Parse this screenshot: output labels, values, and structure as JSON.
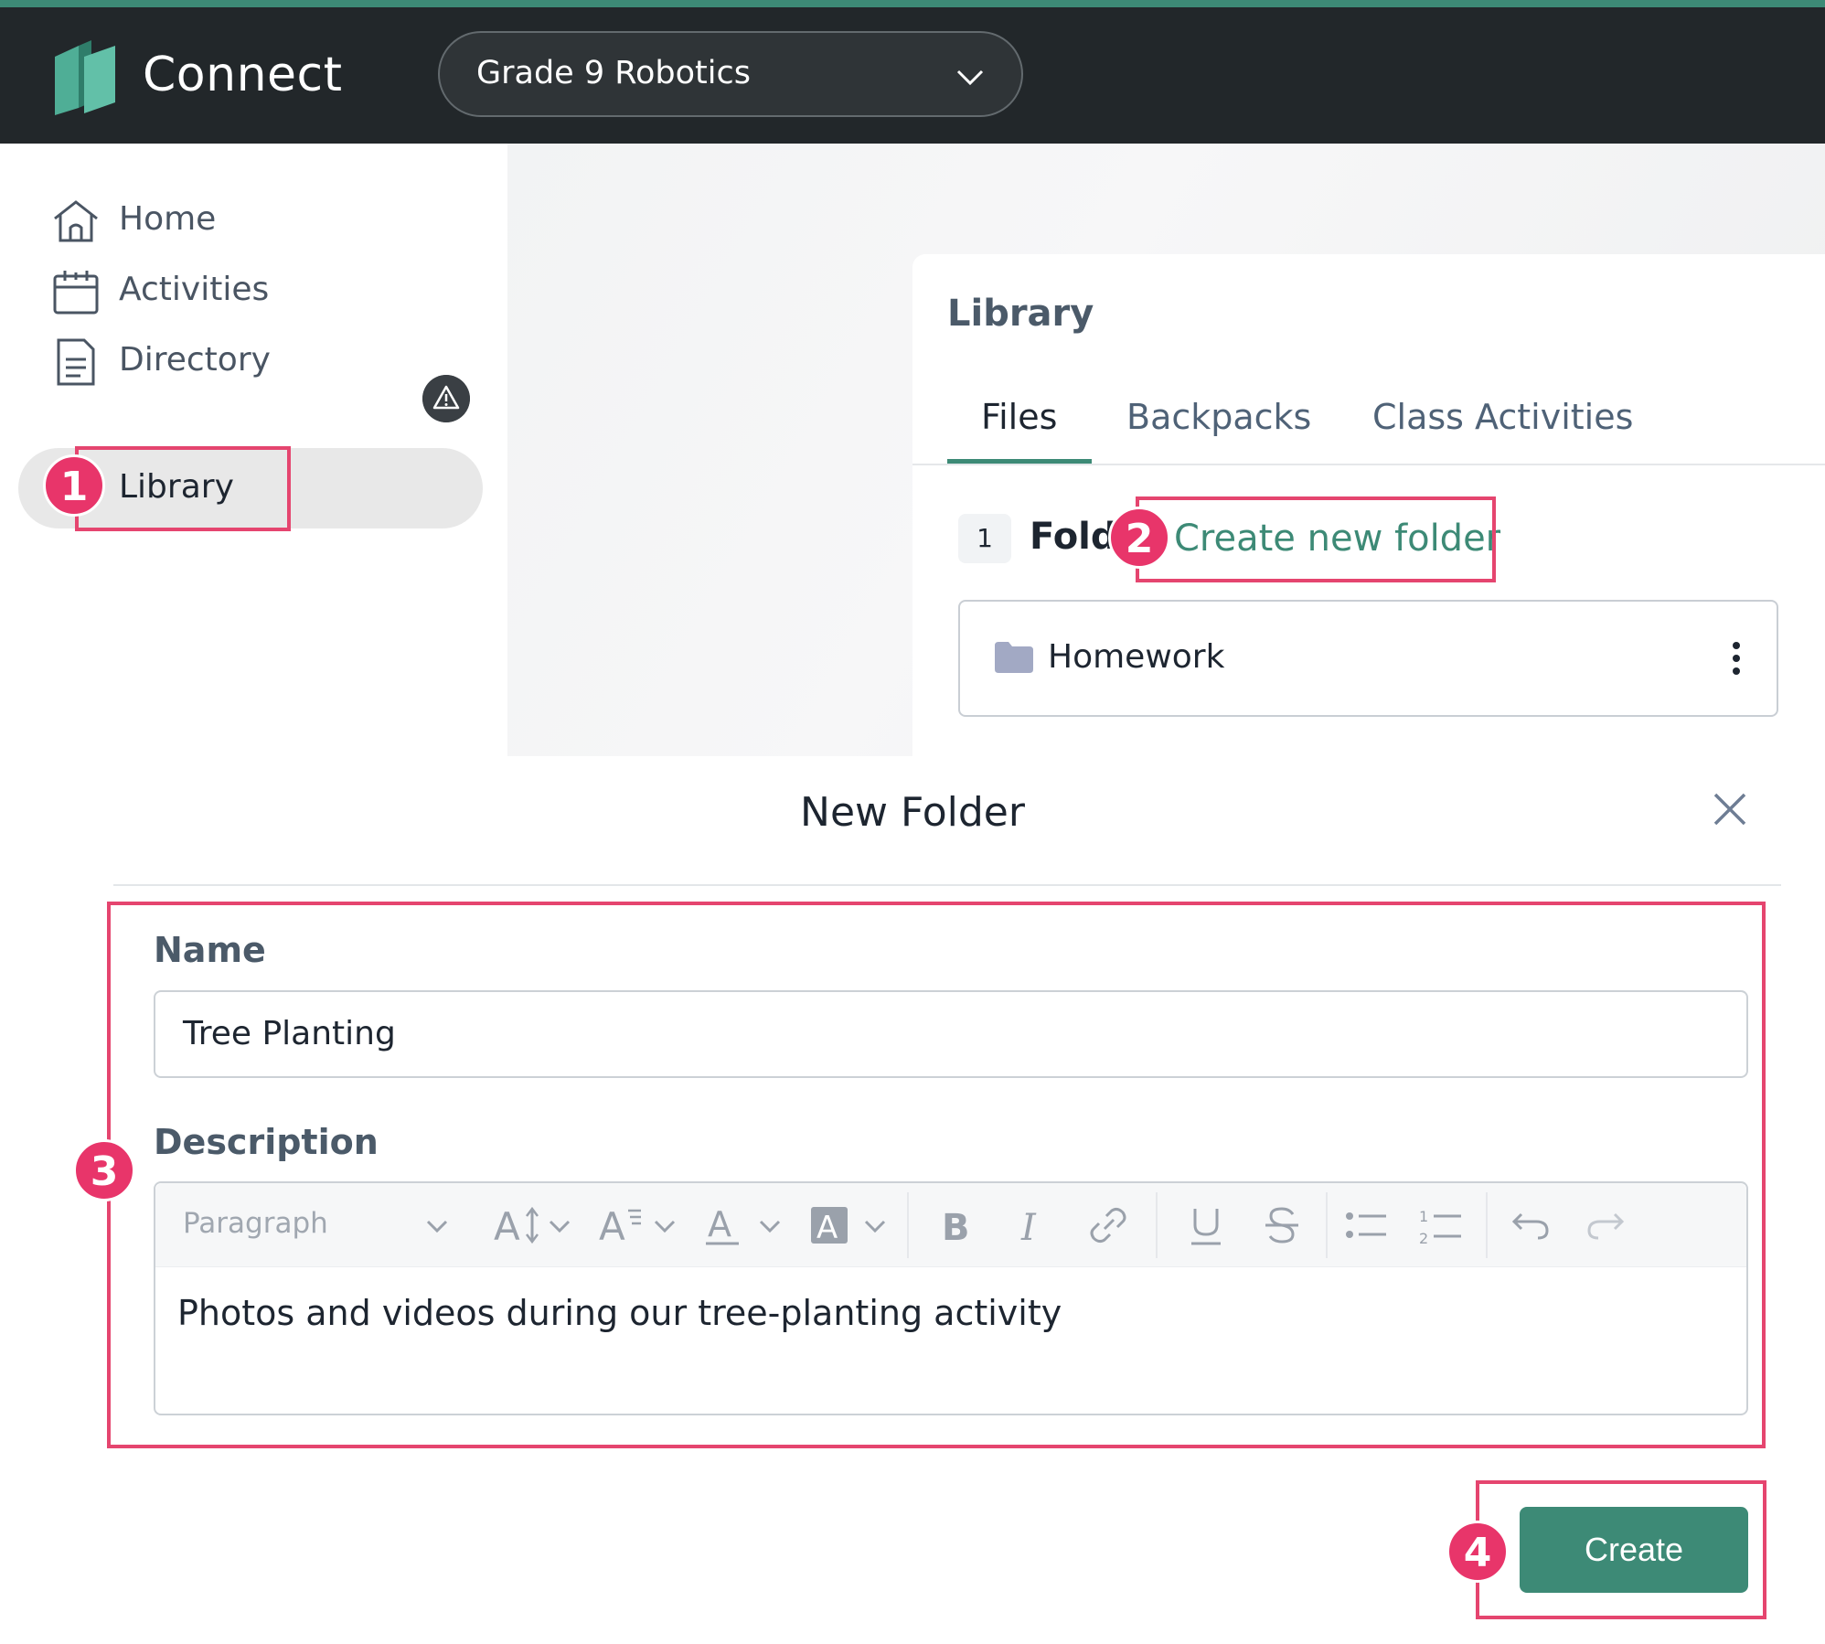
{
  "app": {
    "brand": "Connect",
    "class_selector": "Grade 9 Robotics"
  },
  "sidebar": {
    "items": [
      {
        "label": "Home",
        "icon": "home-icon"
      },
      {
        "label": "Activities",
        "icon": "calendar-icon"
      },
      {
        "label": "Directory",
        "icon": "document-icon",
        "badge_icon": "warning-icon"
      },
      {
        "label": "Library",
        "icon": "library-icon",
        "active": true
      }
    ]
  },
  "library": {
    "title": "Library",
    "tabs": [
      {
        "label": "Files",
        "active": true
      },
      {
        "label": "Backpacks"
      },
      {
        "label": "Class Activities"
      }
    ],
    "folder_count": "1",
    "folders_label": "Folders",
    "create_link": "Create new folder",
    "folders": [
      {
        "name": "Homework"
      }
    ]
  },
  "modal": {
    "title": "New Folder",
    "name_label": "Name",
    "name_value": "Tree Planting",
    "description_label": "Description",
    "toolbar": {
      "block_style": "Paragraph",
      "buttons": [
        "font-size-icon",
        "line-height-icon",
        "font-color-icon",
        "highlight-color-icon",
        "bold-icon",
        "italic-icon",
        "link-icon",
        "underline-icon",
        "strikethrough-icon",
        "bulleted-list-icon",
        "numbered-list-icon",
        "undo-icon",
        "redo-icon"
      ]
    },
    "description_value": "Photos and videos during our tree-planting activity",
    "create_label": "Create"
  },
  "annotations": {
    "steps": [
      "1",
      "2",
      "3",
      "4"
    ],
    "color": "#e5456f"
  },
  "colors": {
    "accent": "#3d8a76",
    "topbar": "#22272a"
  }
}
